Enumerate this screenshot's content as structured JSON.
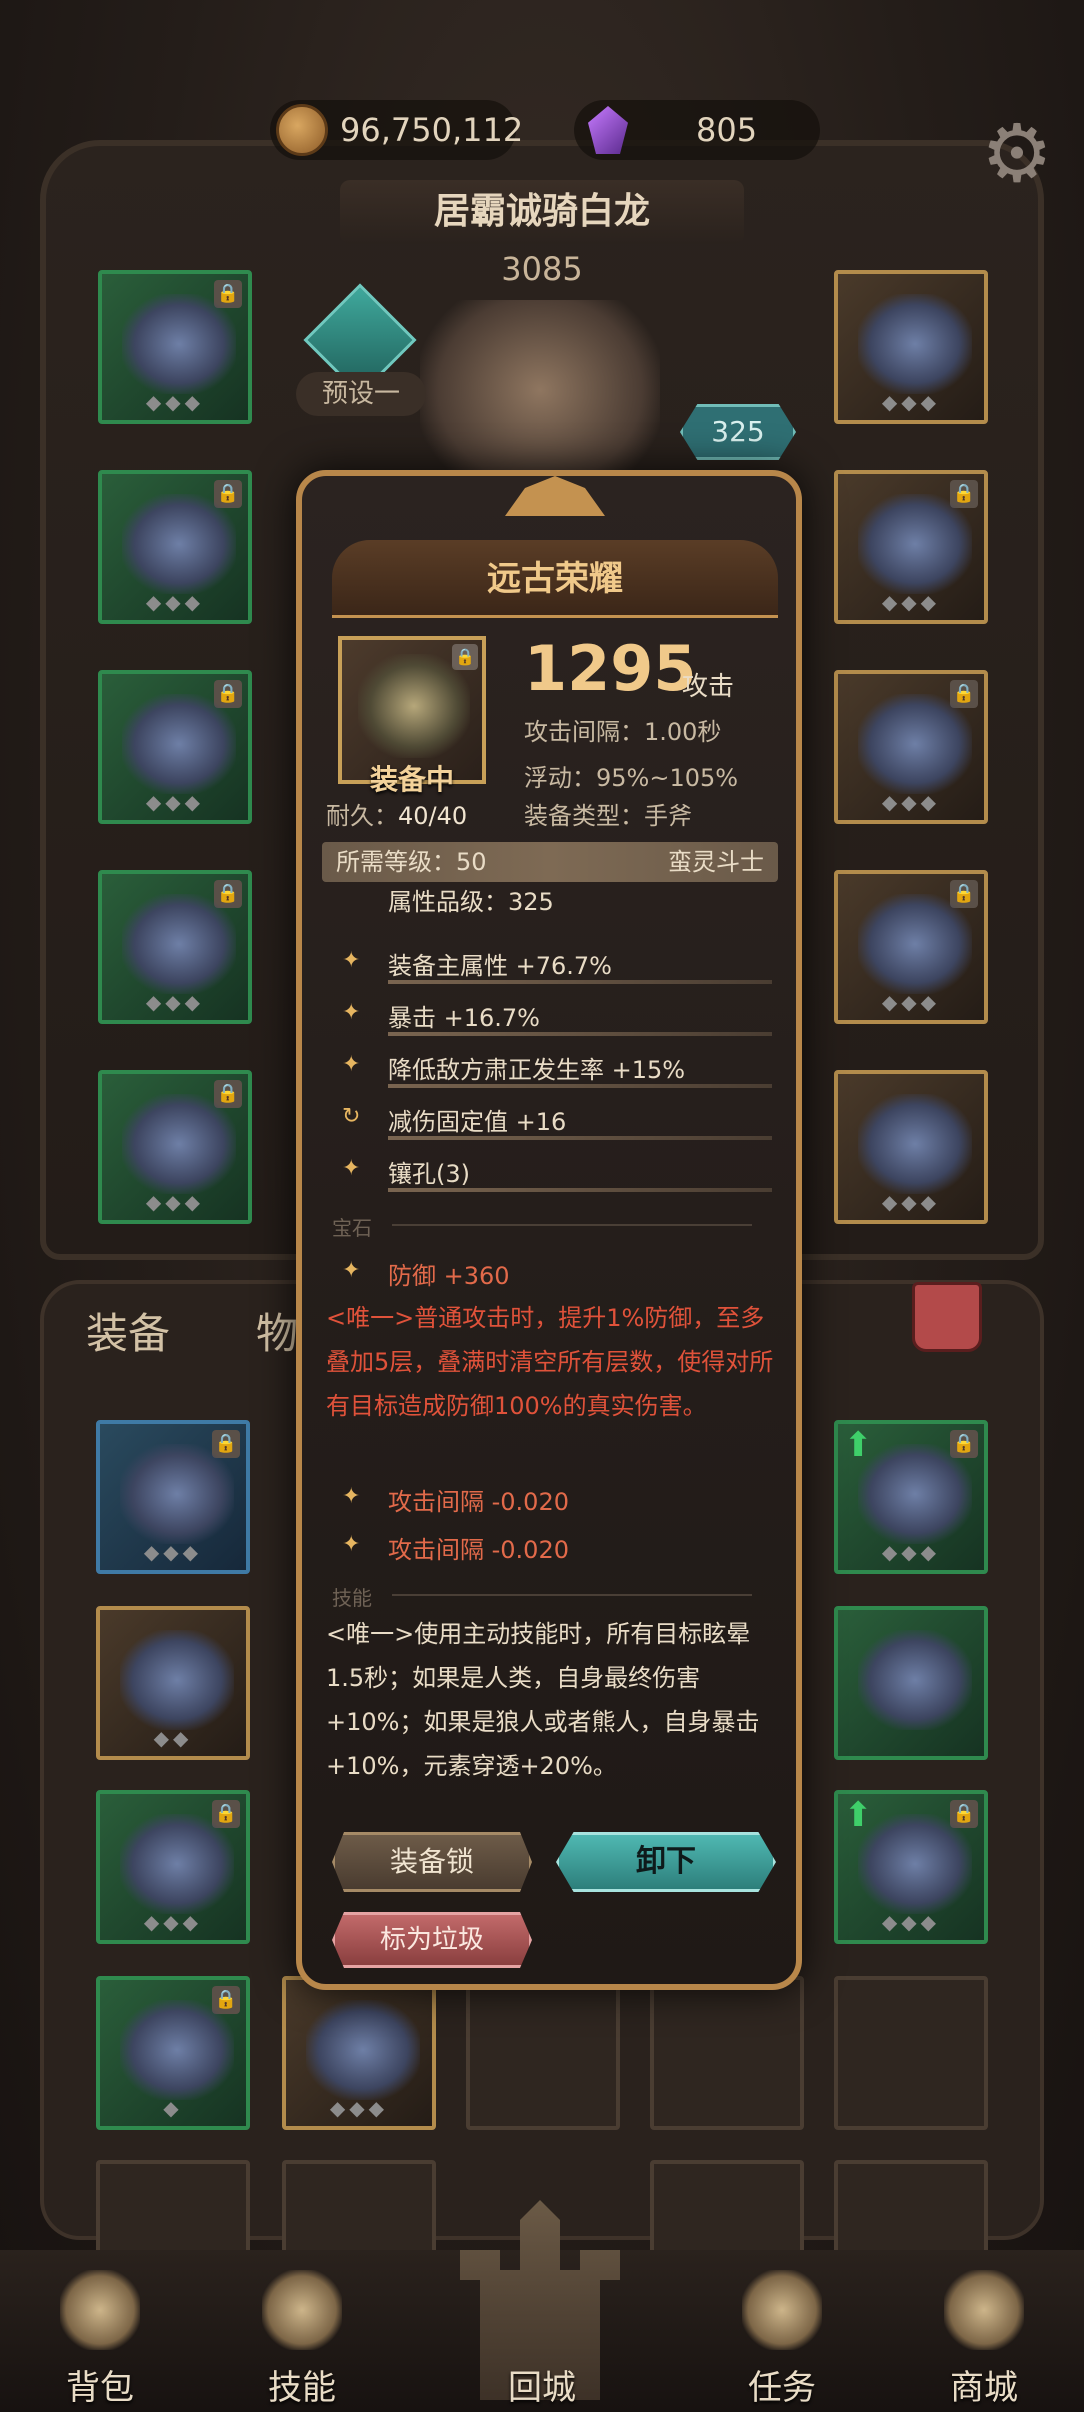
{
  "header": {
    "gold": "96,750,112",
    "gems": "805",
    "hero_name": "居霸诚骑白龙",
    "hero_power": "3085",
    "preset_label": "预设一",
    "level": "325"
  },
  "tabs": {
    "equipment": "装备",
    "items": "物"
  },
  "popup": {
    "title": "远古荣耀",
    "attack_value": "1295",
    "attack_label": "攻击",
    "attack_interval": "攻击间隔：1.00秒",
    "float": "浮动：95%~105%",
    "durability_label": "耐久：",
    "durability_value": "40/40",
    "equip_type": "装备类型：手斧",
    "equipped_label": "装备中",
    "required_level": "所需等级：50",
    "class": "蛮灵斗士",
    "attr_level": "属性品级：325",
    "attributes": [
      "装备主属性 +76.7%",
      "暴击 +16.7%",
      "降低敌方肃正发生率 +15%",
      "减伤固定值 +16",
      "镶孔(3)"
    ],
    "gem_header": "宝石",
    "gem_bonus": "防御 +360",
    "gem_unique": "<唯一>普通攻击时，提升1%防御，至多叠加5层，叠满时清空所有层数，使得对所有目标造成防御100%的真实伤害。",
    "gem_lines": [
      "攻击间隔 -0.020",
      "攻击间隔 -0.020"
    ],
    "skill_header": "技能",
    "skill_unique": "<唯一>使用主动技能时，所有目标眩晕1.5秒；如果是人类，自身最终伤害+10%；如果是狼人或者熊人，自身暴击+10%，元素穿透+20%。",
    "btn_lock": "装备锁",
    "btn_unequip": "卸下",
    "btn_junk": "标为垃圾"
  },
  "nav": {
    "bag": "背包",
    "skills": "技能",
    "town": "回城",
    "quests": "任务",
    "shop": "商城"
  },
  "colors": {
    "accent_gold": "#f0c98a",
    "unique_red": "#e0523a",
    "unequip_teal": "#4fb8b2"
  }
}
